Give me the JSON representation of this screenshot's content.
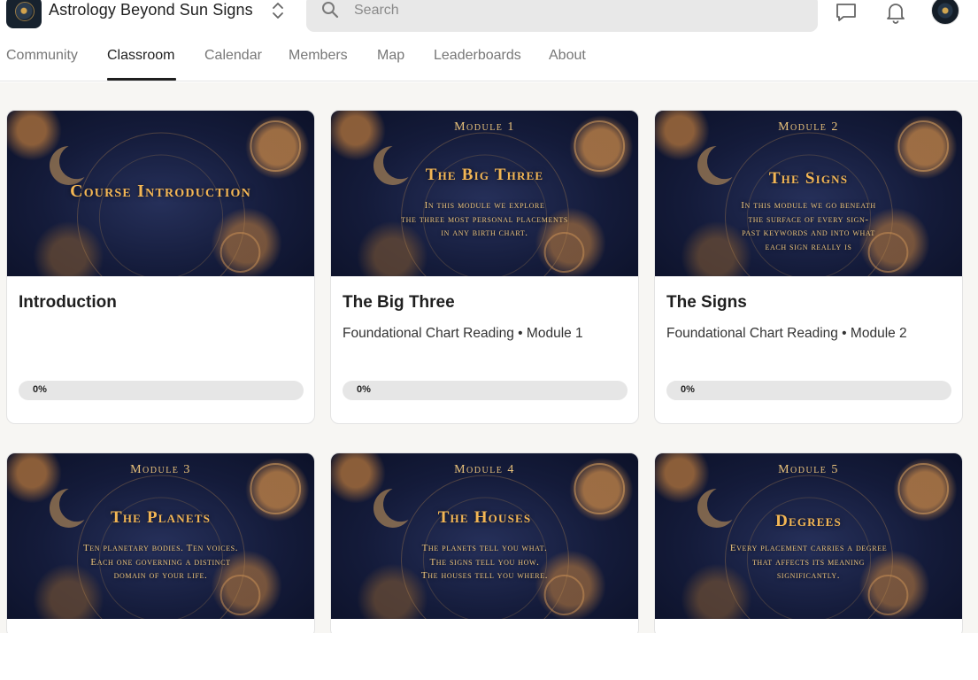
{
  "brand": {
    "name": "Astrology Beyond Sun Signs",
    "logo_icon": "zodiac-wheel-logo"
  },
  "search": {
    "placeholder": "Search"
  },
  "header_icons": {
    "chat": "chat-icon",
    "bell": "bell-icon",
    "avatar": "user-avatar"
  },
  "tabs": [
    {
      "label": "Community"
    },
    {
      "label": "Classroom",
      "active": true
    },
    {
      "label": "Calendar"
    },
    {
      "label": "Members"
    },
    {
      "label": "Map"
    },
    {
      "label": "Leaderboards"
    },
    {
      "label": "About"
    }
  ],
  "theme": {
    "accent": "#f3b654",
    "cover_bg": "#141b3a",
    "page_bg": "#f7f6f3"
  },
  "courses": [
    {
      "cover_module": "",
      "cover_title": "Course Introduction",
      "cover_lines": [],
      "title": "Introduction",
      "subtitle": "",
      "progress": 0,
      "progress_label": "0%"
    },
    {
      "cover_module": "Module 1",
      "cover_title": "The Big Three",
      "cover_lines": [
        "In this module we explore",
        "the three most personal placements",
        "in any birth chart."
      ],
      "title": "The Big Three",
      "subtitle": "Foundational Chart Reading • Module 1",
      "progress": 0,
      "progress_label": "0%"
    },
    {
      "cover_module": "Module 2",
      "cover_title": "The Signs",
      "cover_lines": [
        "In this module we go beneath",
        "the surface of every sign-",
        "past keywords and into what",
        "each sign really is"
      ],
      "title": "The Signs",
      "subtitle": "Foundational Chart Reading • Module 2",
      "progress": 0,
      "progress_label": "0%"
    },
    {
      "cover_module": "Module 3",
      "cover_title": "The Planets",
      "cover_lines": [
        "Ten planetary bodies. Ten voices.",
        "Each one governing a distinct",
        "domain of your life."
      ]
    },
    {
      "cover_module": "Module 4",
      "cover_title": "The Houses",
      "cover_lines": [
        "The planets tell you what.",
        "The signs tell you how.",
        "The houses tell you where."
      ]
    },
    {
      "cover_module": "Module 5",
      "cover_title": "Degrees",
      "cover_lines": [
        "Every placement carries a degree",
        "that affects its meaning",
        "significantly."
      ]
    }
  ]
}
